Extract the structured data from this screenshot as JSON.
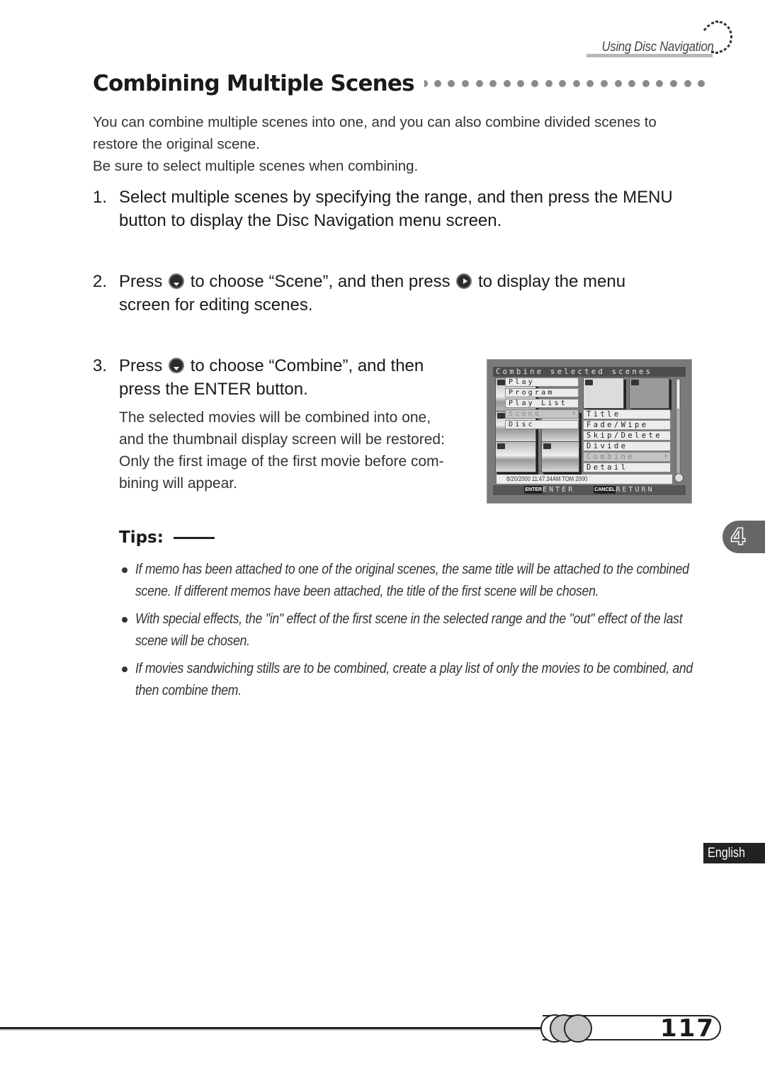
{
  "header": {
    "section_title": "Using Disc Navigation"
  },
  "title": "Combining Multiple Scenes",
  "intro": [
    "You can combine multiple scenes into one, and you can also combine divided scenes to restore the original scene.",
    "Be sure to select multiple scenes when combining."
  ],
  "steps": [
    {
      "number": "1.",
      "text": "Select multiple scenes by specifying the range, and then press the MENU button to display the Disc Navigation menu screen."
    },
    {
      "number": "2.",
      "text_a": "Press",
      "icon_a": "down-button-icon",
      "text_b": "to choose “Scene”, and then press",
      "icon_b": "right-button-icon",
      "text_c": "to display the menu screen for editing scenes."
    },
    {
      "number": "3.",
      "text_a": "Press",
      "icon_a": "down-button-icon",
      "text_b": "to choose “Combine”, and then press the ENTER button.",
      "description": [
        "The selected movies will be combined into one,",
        "and the thumbnail display screen will be restored:",
        "Only the first image of the first movie before com-",
        "bining will appear."
      ]
    }
  ],
  "screen": {
    "title": "Combine selected scenes",
    "main_menu": [
      {
        "label": "Play",
        "selected": false
      },
      {
        "label": "Program",
        "selected": false
      },
      {
        "label": "Play List",
        "selected": false
      },
      {
        "label": "Scene",
        "selected": true
      },
      {
        "label": "Disc",
        "selected": false
      }
    ],
    "sub_menu": [
      {
        "label": "Title",
        "selected": false
      },
      {
        "label": "Fade/Wipe",
        "selected": false
      },
      {
        "label": "Skip/Delete",
        "selected": false
      },
      {
        "label": "Divide",
        "selected": false
      },
      {
        "label": "Combine",
        "selected": true
      },
      {
        "label": "Detail",
        "selected": false
      }
    ],
    "status": "8/20/2000 11:47:34AM    TOM 2000",
    "footer": {
      "enter_key": "ENTER",
      "enter_label": "ENTER",
      "cancel_key": "CANCEL",
      "cancel_label": "RETURN"
    }
  },
  "tips": {
    "label": "Tips:",
    "items": [
      "If memo has been attached to one of the original scenes, the same title will be attached to the combined scene. If different memos have been attached, the title of the first scene will be chosen.",
      "With special effects, the \"in\" effect of the first scene in the selected range and the \"out\" effect of the last scene will be chosen.",
      "If movies sandwiching stills are to be combined, create a play list of only the movies to be combined, and then combine them."
    ]
  },
  "chapter": "4",
  "language": "English",
  "page_number": "117"
}
